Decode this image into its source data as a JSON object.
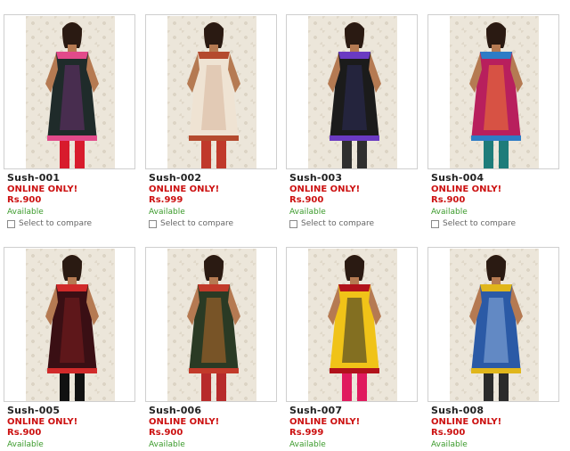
{
  "products": [
    {
      "code": "Sush-001",
      "promo": "ONLINE ONLY!",
      "price": "Rs.900",
      "availability": "Available",
      "compare_label": "Select to compare",
      "colors": {
        "dress": "#1f2b2a",
        "accent": "#e24a8a",
        "pattern": "#6a2f6e",
        "legs": "#d81b2c"
      }
    },
    {
      "code": "Sush-002",
      "promo": "ONLINE ONLY!",
      "price": "Rs.999",
      "availability": "Available",
      "compare_label": "Select to compare",
      "colors": {
        "dress": "#efe3d3",
        "accent": "#b44a2e",
        "pattern": "#d7b79c",
        "legs": "#c0392b"
      }
    },
    {
      "code": "Sush-003",
      "promo": "ONLINE ONLY!",
      "price": "Rs.900",
      "availability": "Available",
      "compare_label": "Select to compare",
      "colors": {
        "dress": "#1b1b1b",
        "accent": "#6a3ac2",
        "pattern": "#2c2c5a",
        "legs": "#2f2f2f"
      }
    },
    {
      "code": "Sush-004",
      "promo": "ONLINE ONLY!",
      "price": "Rs.900",
      "availability": "Available",
      "compare_label": "Select to compare",
      "colors": {
        "dress": "#b81f5d",
        "accent": "#2d7cc6",
        "pattern": "#f07b2f",
        "legs": "#1e7c7a"
      }
    },
    {
      "code": "Sush-005",
      "promo": "ONLINE ONLY!",
      "price": "Rs.900",
      "availability": "Available",
      "compare_label": "",
      "colors": {
        "dress": "#3a0f14",
        "accent": "#d12a2a",
        "pattern": "#7b1f1f",
        "legs": "#111111"
      }
    },
    {
      "code": "Sush-006",
      "promo": "ONLINE ONLY!",
      "price": "Rs.900",
      "availability": "Available",
      "compare_label": "",
      "colors": {
        "dress": "#2a3a24",
        "accent": "#c23a2a",
        "pattern": "#b86a2a",
        "legs": "#b72b2b"
      }
    },
    {
      "code": "Sush-007",
      "promo": "ONLINE ONLY!",
      "price": "Rs.999",
      "availability": "Available",
      "compare_label": "",
      "colors": {
        "dress": "#f0c318",
        "accent": "#b1121b",
        "pattern": "#2a2a2a",
        "legs": "#e01a5e"
      }
    },
    {
      "code": "Sush-008",
      "promo": "ONLINE ONLY!",
      "price": "Rs.900",
      "availability": "Available",
      "compare_label": "",
      "colors": {
        "dress": "#2b5aa6",
        "accent": "#e0b61b",
        "pattern": "#8fb0dd",
        "legs": "#2b2b2b"
      }
    }
  ]
}
